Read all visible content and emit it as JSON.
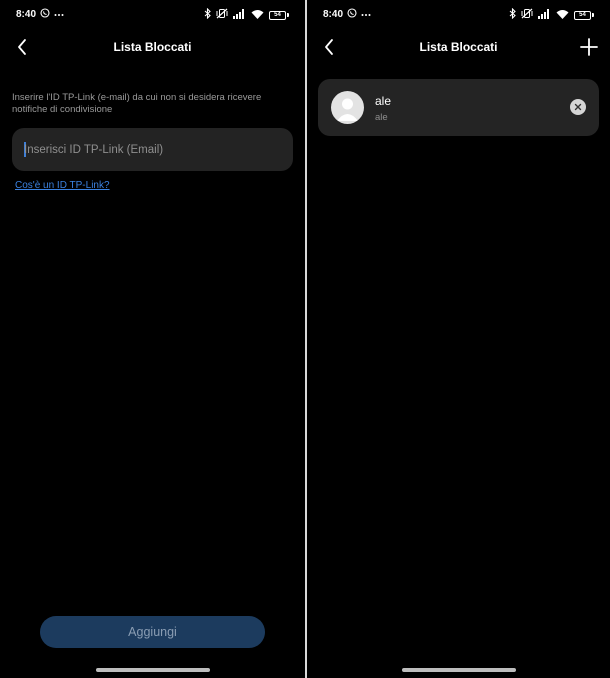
{
  "left_screen": {
    "status_bar": {
      "time": "8:40",
      "battery_level": "54"
    },
    "header": {
      "title": "Lista Bloccati"
    },
    "instruction_text": "Inserire l'ID TP-Link (e-mail) da cui non si desidera ricevere notifiche di condivisione",
    "email_input": {
      "placeholder": "Inserisci ID TP-Link (Email)",
      "value": ""
    },
    "help_link": "Cos'è un ID TP-Link?",
    "add_button": "Aggiungi"
  },
  "right_screen": {
    "status_bar": {
      "time": "8:40",
      "battery_level": "54"
    },
    "header": {
      "title": "Lista Bloccati"
    },
    "blocked_users": [
      {
        "name": "ale",
        "id": "ale"
      }
    ]
  },
  "colors": {
    "background": "#000000",
    "card": "#242424",
    "input": "#232323",
    "link": "#3b82e0",
    "button_disabled": "#1c3b5e"
  },
  "icons": [
    "whatsapp-icon",
    "more-icon",
    "bluetooth-icon",
    "vibrate-off-icon",
    "signal-icon",
    "wifi-icon",
    "battery-icon",
    "back-icon",
    "add-icon",
    "avatar-icon",
    "close-icon"
  ]
}
